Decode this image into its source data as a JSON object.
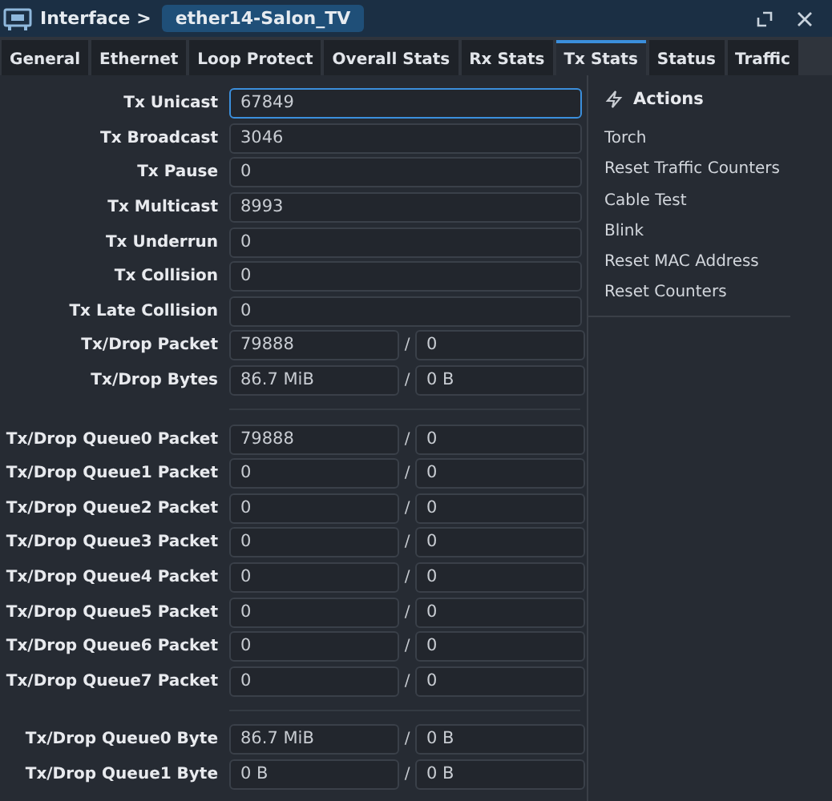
{
  "window": {
    "breadcrumb": "Interface >",
    "title": "ether14-Salon_TV"
  },
  "tabs": [
    {
      "label": "General",
      "selected": false
    },
    {
      "label": "Ethernet",
      "selected": false
    },
    {
      "label": "Loop Protect",
      "selected": false
    },
    {
      "label": "Overall Stats",
      "selected": false
    },
    {
      "label": "Rx Stats",
      "selected": false
    },
    {
      "label": "Tx Stats",
      "selected": true
    },
    {
      "label": "Status",
      "selected": false
    },
    {
      "label": "Traffic",
      "selected": false
    }
  ],
  "sections": [
    {
      "rows": [
        {
          "kind": "single",
          "label": "Tx Unicast",
          "values": [
            "67849"
          ],
          "focused": true
        },
        {
          "kind": "single",
          "label": "Tx Broadcast",
          "values": [
            "3046"
          ],
          "focused": false
        },
        {
          "kind": "single",
          "label": "Tx Pause",
          "values": [
            "0"
          ],
          "focused": false
        },
        {
          "kind": "single",
          "label": "Tx Multicast",
          "values": [
            "8993"
          ],
          "focused": false
        },
        {
          "kind": "single",
          "label": "Tx Underrun",
          "values": [
            "0"
          ],
          "focused": false
        },
        {
          "kind": "single",
          "label": "Tx Collision",
          "values": [
            "0"
          ],
          "focused": false
        },
        {
          "kind": "single",
          "label": "Tx Late Collision",
          "values": [
            "0"
          ],
          "focused": false
        },
        {
          "kind": "pair",
          "label": "Tx/Drop Packet",
          "values": [
            "79888",
            "0"
          ],
          "separator": "/",
          "focused": false
        },
        {
          "kind": "pair",
          "label": "Tx/Drop Bytes",
          "values": [
            "86.7 MiB",
            "0 B"
          ],
          "separator": "/",
          "focused": false
        }
      ]
    },
    {
      "rows": [
        {
          "kind": "pair",
          "label": "Tx/Drop Queue0 Packet",
          "values": [
            "79888",
            "0"
          ],
          "separator": "/",
          "focused": false
        },
        {
          "kind": "pair",
          "label": "Tx/Drop Queue1 Packet",
          "values": [
            "0",
            "0"
          ],
          "separator": "/",
          "focused": false
        },
        {
          "kind": "pair",
          "label": "Tx/Drop Queue2 Packet",
          "values": [
            "0",
            "0"
          ],
          "separator": "/",
          "focused": false
        },
        {
          "kind": "pair",
          "label": "Tx/Drop Queue3 Packet",
          "values": [
            "0",
            "0"
          ],
          "separator": "/",
          "focused": false
        },
        {
          "kind": "pair",
          "label": "Tx/Drop Queue4 Packet",
          "values": [
            "0",
            "0"
          ],
          "separator": "/",
          "focused": false
        },
        {
          "kind": "pair",
          "label": "Tx/Drop Queue5 Packet",
          "values": [
            "0",
            "0"
          ],
          "separator": "/",
          "focused": false
        },
        {
          "kind": "pair",
          "label": "Tx/Drop Queue6 Packet",
          "values": [
            "0",
            "0"
          ],
          "separator": "/",
          "focused": false
        },
        {
          "kind": "pair",
          "label": "Tx/Drop Queue7 Packet",
          "values": [
            "0",
            "0"
          ],
          "separator": "/",
          "focused": false
        }
      ]
    },
    {
      "rows": [
        {
          "kind": "pair",
          "label": "Tx/Drop Queue0 Byte",
          "values": [
            "86.7 MiB",
            "0 B"
          ],
          "separator": "/",
          "focused": false
        },
        {
          "kind": "pair",
          "label": "Tx/Drop Queue1 Byte",
          "values": [
            "0 B",
            "0 B"
          ],
          "separator": "/",
          "focused": false
        }
      ]
    }
  ],
  "actions": {
    "title": "Actions",
    "items": [
      "Torch",
      "Reset Traffic Counters",
      "Cable Test",
      "Blink",
      "Reset MAC Address",
      "Reset Counters"
    ]
  }
}
